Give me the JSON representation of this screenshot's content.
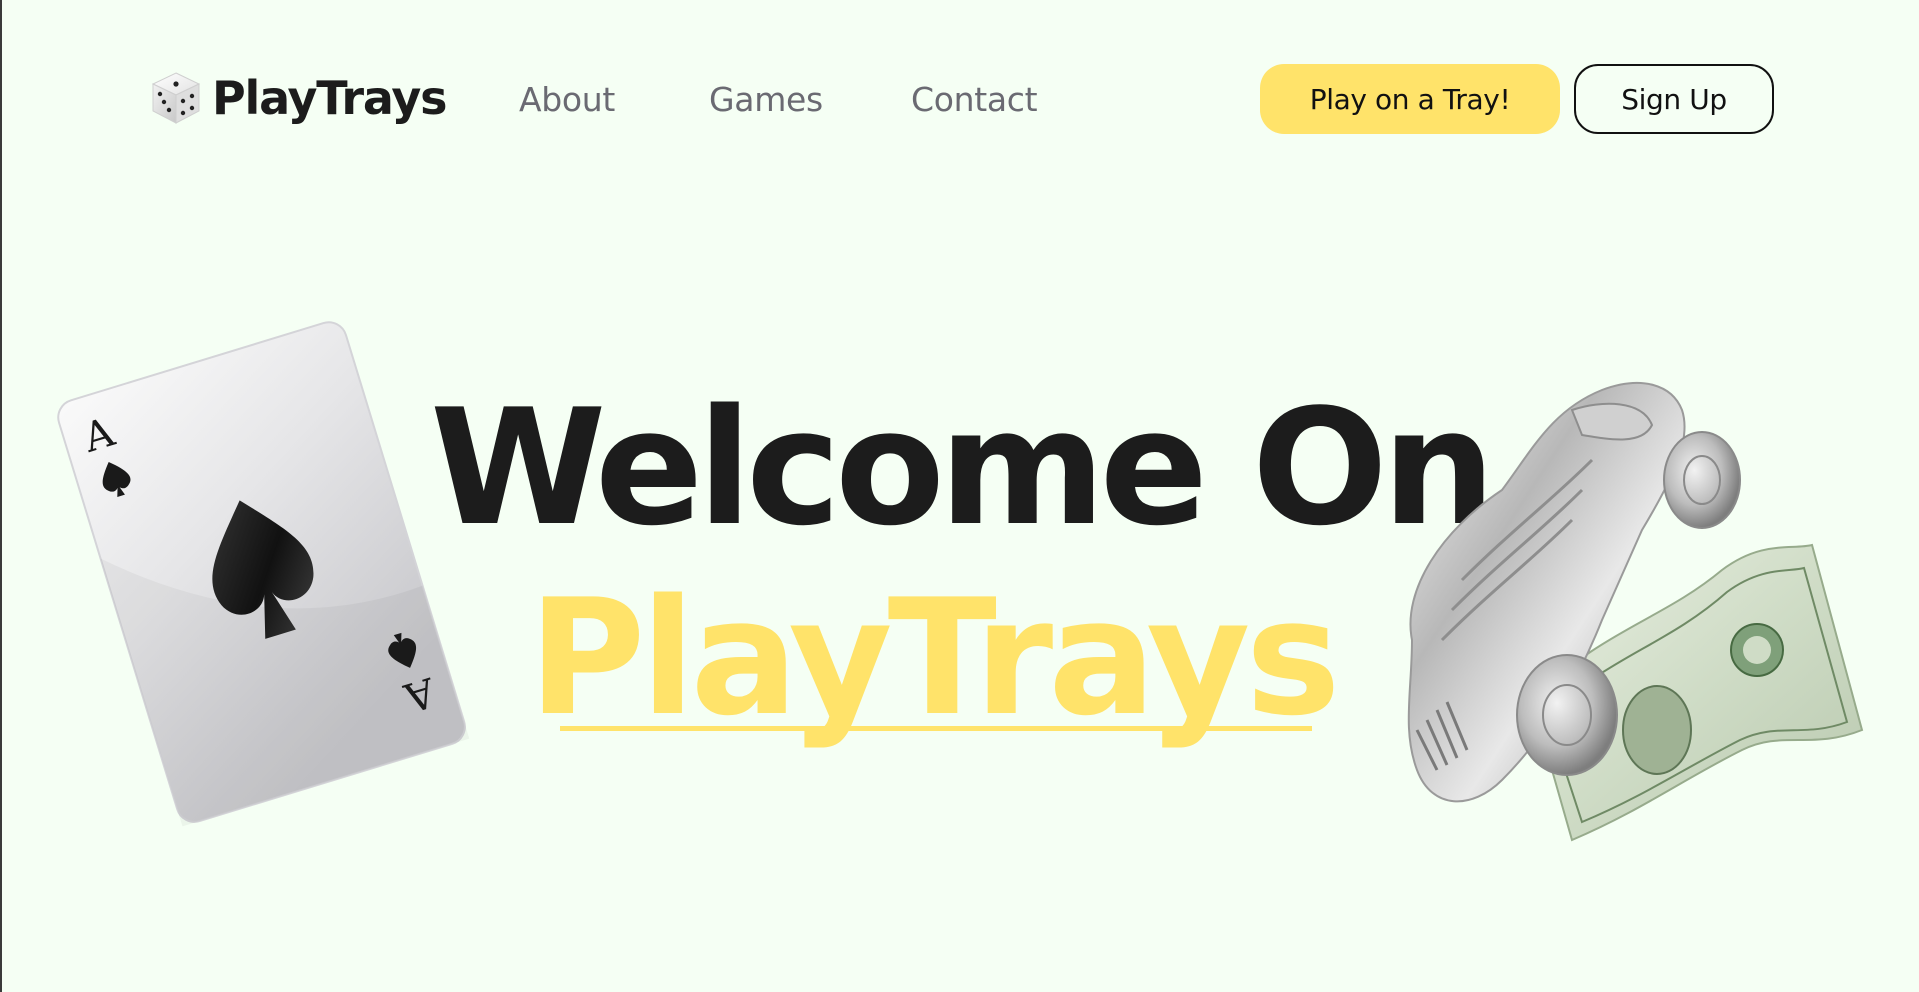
{
  "brand": {
    "name": "PlayTrays",
    "icon": "dice-icon"
  },
  "nav": {
    "links": [
      "About",
      "Games",
      "Contact"
    ]
  },
  "actions": {
    "play_label": "Play on a Tray!",
    "signup_label": "Sign Up"
  },
  "hero": {
    "line1": "Welcome On",
    "line2": "PlayTrays"
  },
  "decor": {
    "card": {
      "rank": "A",
      "icon": "ace-of-spades-card"
    },
    "car_icon": "race-car-token-icon",
    "bill_icon": "dollar-bill-icon"
  },
  "colors": {
    "background": "#f5fff4",
    "accent": "#ffe36a",
    "text": "#1c1c1c",
    "nav_text": "#6a6a72"
  }
}
